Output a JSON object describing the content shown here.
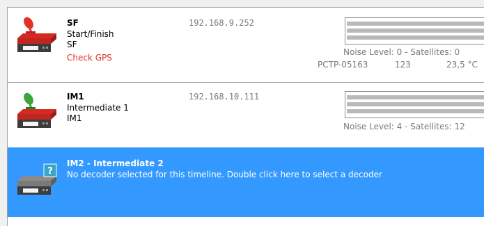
{
  "decoders": [
    {
      "name": "SF",
      "description": "Start/Finish",
      "subname": "SF",
      "status": "Check GPS",
      "ip": "192.168.9.252",
      "noise": "Noise Level: 0 - Satellites: 0",
      "meta": {
        "device": "PCTP-05163",
        "value": "123",
        "temp": "23,5 °C"
      }
    },
    {
      "name": "IM1",
      "description": "Intermediate 1",
      "subname": "IM1",
      "ip": "192.168.10.111",
      "noise": "Noise Level: 4 - Satellites: 12"
    },
    {
      "name": "IM2 - Intermediate 2",
      "description": "No decoder selected for this timeline. Double click here to select a decoder",
      "badge": "?"
    }
  ],
  "icons": {
    "decoder": "decoder-box-icon",
    "antenna_red": "satellite-antenna-red-icon",
    "antenna_green": "satellite-antenna-green-icon",
    "unknown": "question-badge-icon"
  },
  "colors": {
    "selection": "#3399ff",
    "warning": "#e0302a",
    "device_red": "#d32a23",
    "antenna_red": "#e0302a",
    "antenna_green": "#3aa53a",
    "badge": "#3aa5c8"
  }
}
